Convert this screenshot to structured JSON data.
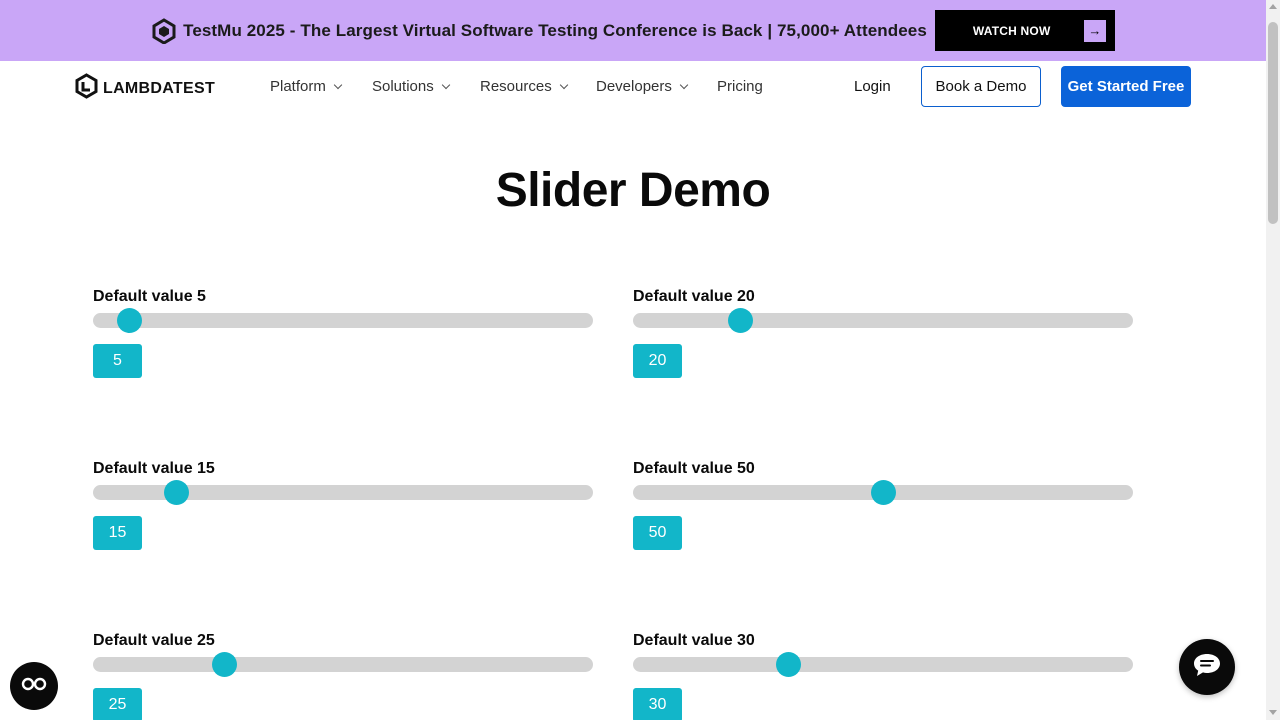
{
  "banner": {
    "logo_icon": "testmu-logo-icon",
    "text": "TestMu 2025 - The Largest Virtual Software Testing Conference is Back | 75,000+ Attendees",
    "watch_label": "WATCH NOW",
    "watch_icon": "arrow-right-icon",
    "background": "#c9a6f7"
  },
  "nav": {
    "brand": "LAMBDATEST",
    "brand_icon": "lambdatest-logo-icon",
    "items": [
      {
        "label": "Platform",
        "has_dropdown": true
      },
      {
        "label": "Solutions",
        "has_dropdown": true
      },
      {
        "label": "Resources",
        "has_dropdown": true
      },
      {
        "label": "Developers",
        "has_dropdown": true
      },
      {
        "label": "Pricing",
        "has_dropdown": false
      }
    ],
    "login": "Login",
    "book_demo": "Book a Demo",
    "get_started": "Get Started Free"
  },
  "page": {
    "title": "Slider Demo"
  },
  "slider_range": {
    "min": 0,
    "max": 100
  },
  "sliders": [
    {
      "label": "Default value 5",
      "value": 5,
      "display": "5"
    },
    {
      "label": "Default value 20",
      "value": 20,
      "display": "20"
    },
    {
      "label": "Default value 15",
      "value": 15,
      "display": "15"
    },
    {
      "label": "Default value 50",
      "value": 50,
      "display": "50"
    },
    {
      "label": "Default value 25",
      "value": 25,
      "display": "25"
    },
    {
      "label": "Default value 30",
      "value": 30,
      "display": "30"
    }
  ],
  "colors": {
    "accent": "#12b6c9",
    "track": "#d3d3d3",
    "primary_button": "#0b63d9"
  },
  "floating": {
    "left_icon": "accessibility-glasses-icon",
    "right_icon": "chat-bubble-icon"
  }
}
